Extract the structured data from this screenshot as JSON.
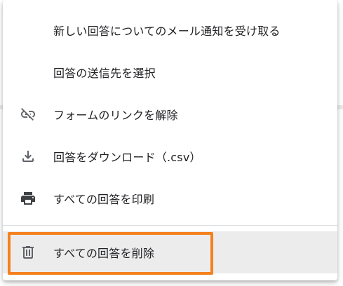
{
  "menu": {
    "items": [
      {
        "label": "新しい回答についてのメール通知を受け取る",
        "icon": "none"
      },
      {
        "label": "回答の送信先を選択",
        "icon": "none"
      },
      {
        "label": "フォームのリンクを解除",
        "icon": "link-off-icon"
      },
      {
        "label": "回答をダウンロード（.csv）",
        "icon": "download-icon"
      },
      {
        "label": "すべての回答を印刷",
        "icon": "print-icon"
      },
      {
        "label": "すべての回答を削除",
        "icon": "trash-icon"
      }
    ]
  },
  "colors": {
    "highlight": "#f4811f",
    "icon": "#5f6368",
    "text": "#202124",
    "hover_bg": "#ececec"
  }
}
